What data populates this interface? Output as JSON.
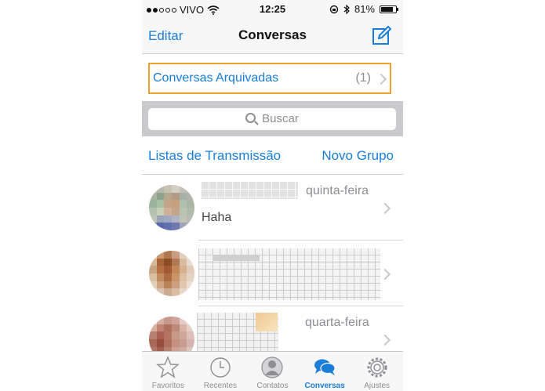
{
  "status_bar": {
    "carrier": "VIVO",
    "time": "12:25",
    "battery": "81%",
    "battery_level": 0.81
  },
  "nav": {
    "edit_label": "Editar",
    "title": "Conversas"
  },
  "archived": {
    "label": "Conversas Arquivadas",
    "count": "(1)"
  },
  "search": {
    "placeholder": "Buscar"
  },
  "actions": {
    "broadcast_label": "Listas de Transmissão",
    "new_group_label": "Novo Grupo"
  },
  "chats": [
    {
      "date": "quinta-feira",
      "preview": "Haha"
    },
    {
      "date": "",
      "preview": ""
    },
    {
      "date": "quarta-feira",
      "preview": ""
    }
  ],
  "tabs": [
    {
      "label": "Favoritos",
      "icon": "star-icon"
    },
    {
      "label": "Recentes",
      "icon": "clock-icon"
    },
    {
      "label": "Contatos",
      "icon": "contact-icon"
    },
    {
      "label": "Conversas",
      "icon": "chat-bubbles-icon",
      "active": true
    },
    {
      "label": "Ajustes",
      "icon": "gear-icon"
    }
  ],
  "colors": {
    "accent": "#1a7ed8",
    "highlight_border": "#f0a030"
  }
}
